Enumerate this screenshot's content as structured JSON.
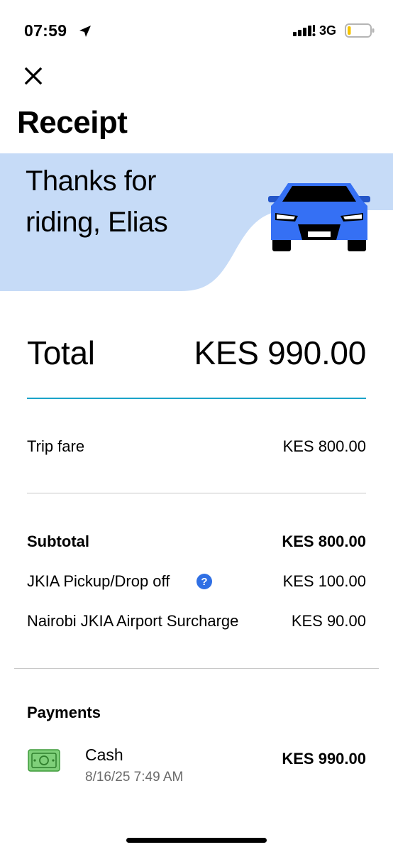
{
  "status_bar": {
    "time": "07:59",
    "network": "3G",
    "location_icon": "location-arrow-icon",
    "signal_icon": "cellular-signal-icon",
    "battery_icon": "battery-low-icon",
    "battery_level": 0.15
  },
  "header": {
    "close_icon": "close-icon",
    "title": "Receipt"
  },
  "hero": {
    "greeting_line1": "Thanks for",
    "greeting_line2": "riding, Elias",
    "background_color": "#c6dbf7",
    "car_color": "#3570f4",
    "car_icon": "car-front-icon"
  },
  "total": {
    "label": "Total",
    "value": "KES 990.00"
  },
  "fare": {
    "trip_fare_label": "Trip fare",
    "trip_fare_value": "KES 800.00"
  },
  "breakdown": {
    "subtotal_label": "Subtotal",
    "subtotal_value": "KES 800.00",
    "pickup_label": "JKIA Pickup/Drop off",
    "pickup_value": "KES 100.00",
    "surcharge_label": "Nairobi JKIA Airport Surcharge",
    "surcharge_value": "KES 90.00",
    "help_icon": "question-circle-icon"
  },
  "payments": {
    "title": "Payments",
    "method": "Cash",
    "date": "8/16/25 7:49 AM",
    "amount": "KES 990.00",
    "cash_icon": "cash-banknote-icon"
  },
  "colors": {
    "accent_divider": "#1aa3c9",
    "help_blue": "#2f6fe4",
    "cash_green": "#7fd07a"
  }
}
